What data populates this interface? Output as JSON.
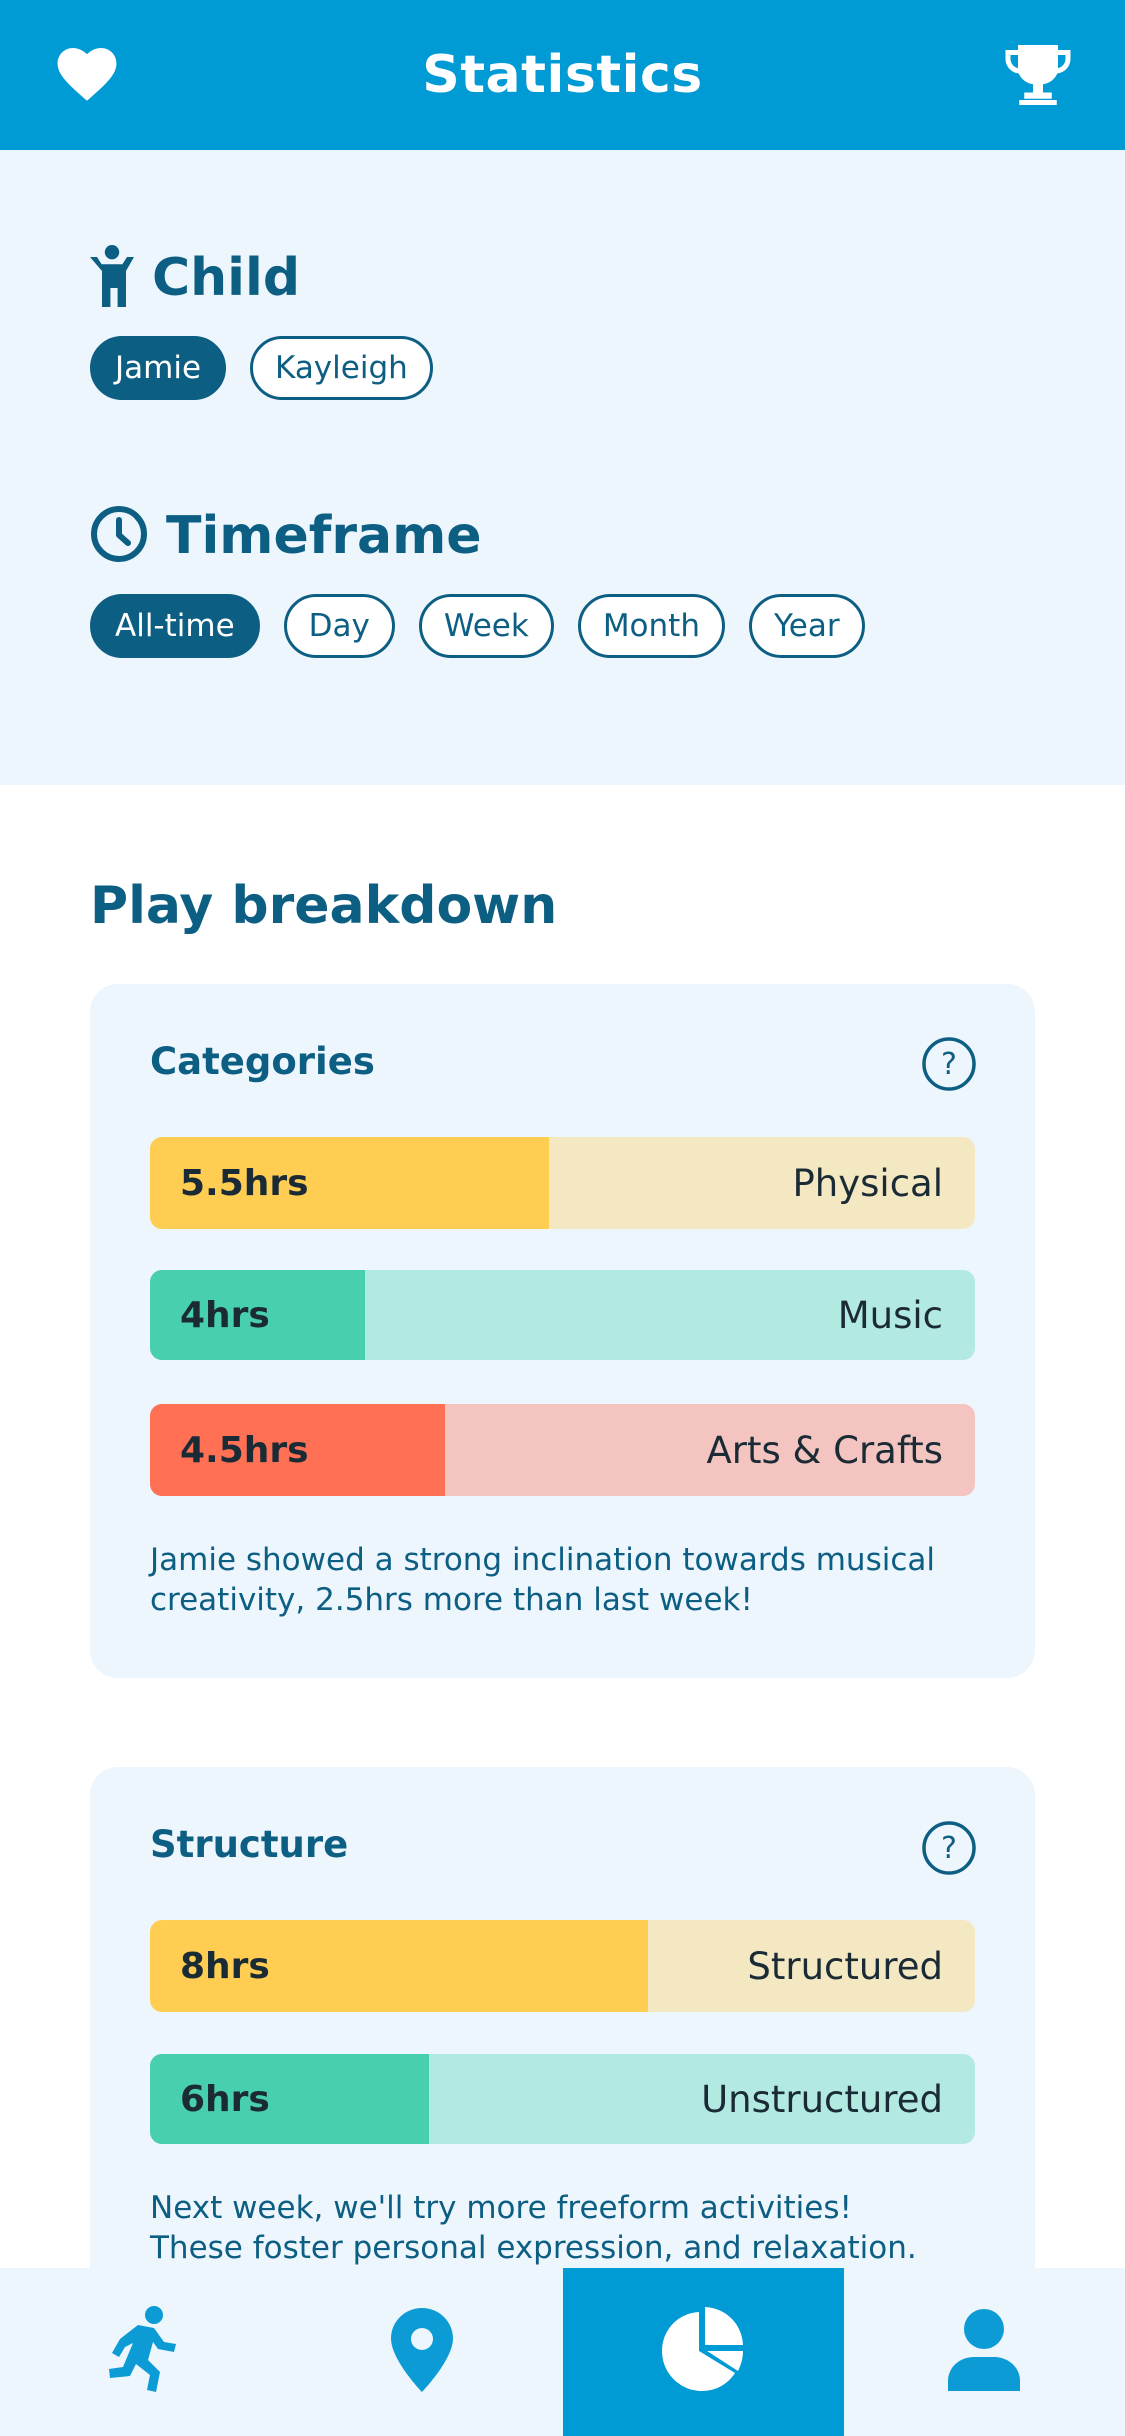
{
  "header": {
    "title": "Statistics",
    "left_icon": "heart-icon",
    "right_icon": "trophy-icon"
  },
  "child": {
    "heading": "Child",
    "icon": "child-icon",
    "options": [
      {
        "label": "Jamie",
        "selected": true
      },
      {
        "label": "Kayleigh",
        "selected": false
      }
    ]
  },
  "timeframe": {
    "heading": "Timeframe",
    "icon": "clock-icon",
    "options": [
      {
        "label": "All-time",
        "selected": true
      },
      {
        "label": "Day",
        "selected": false
      },
      {
        "label": "Week",
        "selected": false
      },
      {
        "label": "Month",
        "selected": false
      },
      {
        "label": "Year",
        "selected": false
      }
    ]
  },
  "breakdown": {
    "title": "Play breakdown",
    "categories": {
      "title": "Categories",
      "bars": [
        {
          "value": "5.5hrs",
          "label": "Physical",
          "fraction": 0.484
        },
        {
          "value": "4hrs",
          "label": "Music",
          "fraction": 0.26
        },
        {
          "value": "4.5hrs",
          "label": "Arts & Crafts",
          "fraction": 0.358
        }
      ],
      "note": "Jamie showed a strong inclination towards musical creativity, 2.5hrs more than last week!"
    },
    "structure": {
      "title": "Structure",
      "bars": [
        {
          "value": "8hrs",
          "label": "Structured",
          "fraction": 0.604
        },
        {
          "value": "6hrs",
          "label": "Unstructured",
          "fraction": 0.338
        }
      ],
      "note_line1": "Next week, we'll try more freeform activities!",
      "note_line2": "These foster personal expression, and relaxation."
    }
  },
  "colors": {
    "primary": "#009ad5",
    "dark": "#0d5e83",
    "panel": "#edf5fd",
    "yellow": "#ffcd52",
    "yellow_light": "#f4e8c2",
    "green": "#48cfad",
    "green_light": "#b2e9e1",
    "red": "#ff7055",
    "red_light": "#f4c5c0"
  },
  "tabbar": {
    "tabs": [
      {
        "icon": "running-icon",
        "active": false
      },
      {
        "icon": "map-pin-icon",
        "active": false
      },
      {
        "icon": "pie-chart-icon",
        "active": true
      },
      {
        "icon": "user-icon",
        "active": false
      }
    ]
  }
}
